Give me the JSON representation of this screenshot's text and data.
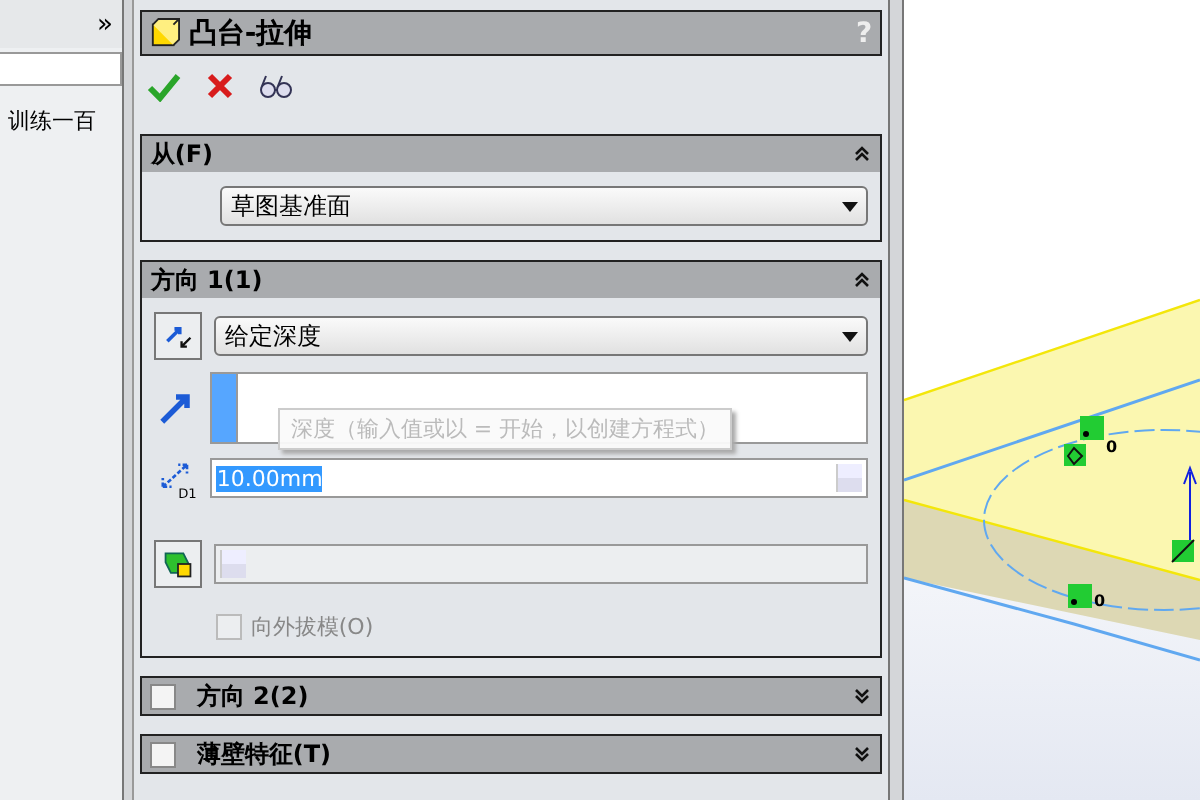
{
  "left_panel": {
    "expand_glyph": "»",
    "item": "训练一百"
  },
  "property_manager": {
    "title": "凸台-拉伸",
    "help": "?"
  },
  "sections": [
    {
      "kind": "from",
      "title": "从(F)",
      "expanded": true,
      "dropdown": "草图基准面"
    },
    {
      "kind": "direction",
      "title": "方向 1(1)",
      "expanded": true,
      "dropdown": "给定深度",
      "dimension_label": "D1",
      "depth": "10.00mm",
      "tooltip": "深度（输入值或以 = 开始，以创建方程式）",
      "draft_outward": {
        "label": "向外拔模(O)",
        "checked": false,
        "disabled": true
      }
    },
    {
      "kind": "optional",
      "title": "方向 2(2)",
      "expanded": false,
      "checked": false
    },
    {
      "kind": "optional",
      "title": "薄壁特征(T)",
      "expanded": false,
      "checked": false
    }
  ],
  "canvas": {
    "relations": [
      "0",
      "0"
    ]
  }
}
